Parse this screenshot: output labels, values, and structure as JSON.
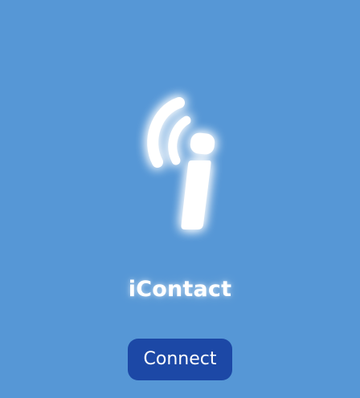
{
  "app": {
    "name": "iContact",
    "logo_icon": "wireless-i-icon"
  },
  "actions": {
    "connect_label": "Connect"
  },
  "colors": {
    "background": "#5697d6",
    "button": "#1c48a6",
    "text": "#ffffff"
  }
}
